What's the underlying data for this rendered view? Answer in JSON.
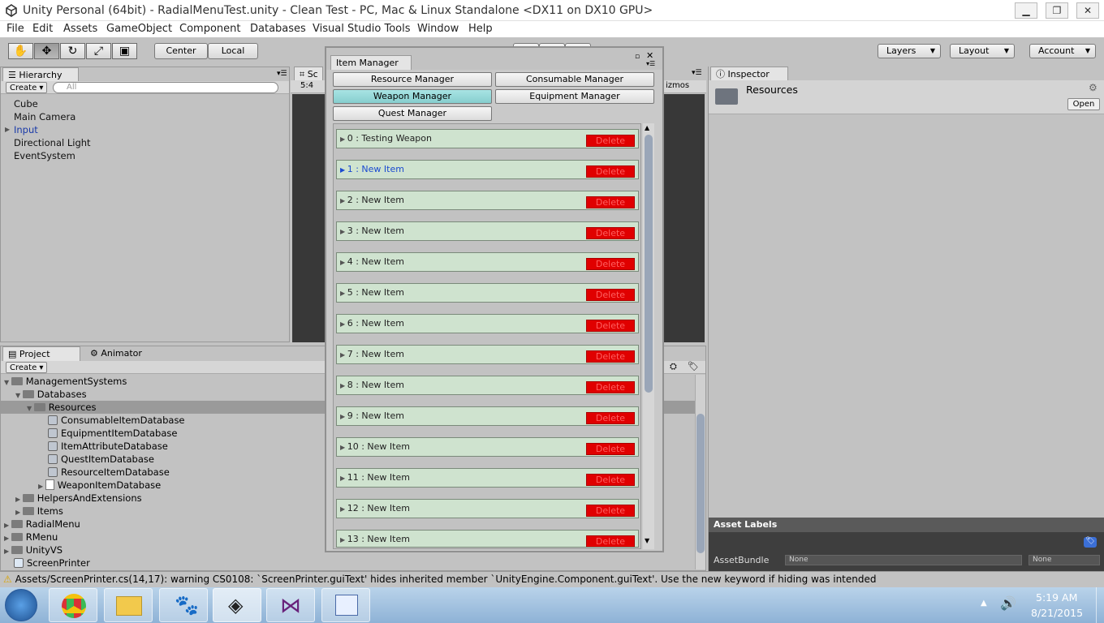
{
  "window": {
    "title": "Unity Personal (64bit) - RadialMenuTest.unity - Clean Test - PC, Mac & Linux Standalone <DX11 on DX10 GPU>",
    "controls": [
      "minimize",
      "restore",
      "close"
    ]
  },
  "menu": [
    "File",
    "Edit",
    "Assets",
    "GameObject",
    "Component",
    "Databases",
    "Visual Studio Tools",
    "Window",
    "Help"
  ],
  "toolbar": {
    "center": "Center",
    "local": "Local",
    "layers": "Layers",
    "layout": "Layout",
    "account": "Account"
  },
  "hierarchy": {
    "tab": "Hierarchy",
    "create": "Create",
    "search_placeholder": "All",
    "items": [
      "Cube",
      "Main Camera",
      "Input",
      "Directional Light",
      "EventSystem"
    ]
  },
  "scene": {
    "tab": "Sc",
    "aspect": "5:4",
    "gizmos": "izmos"
  },
  "project": {
    "tab": "Project",
    "tab2": "Animator",
    "create": "Create",
    "tree": [
      "ManagementSystems",
      "Databases",
      "Resources",
      "ConsumableItemDatabase",
      "EquipmentItemDatabase",
      "ItemAttributeDatabase",
      "QuestItemDatabase",
      "ResourceItemDatabase",
      "WeaponItemDatabase",
      "HelpersAndExtensions",
      "Items",
      "RadialMenu",
      "RMenu",
      "UnityVS",
      "ScreenPrinter"
    ]
  },
  "item_manager": {
    "tab": "Item Manager",
    "buttons": {
      "resource": "Resource Manager",
      "consumable": "Consumable Manager",
      "weapon": "Weapon Manager",
      "equipment": "Equipment Manager",
      "quest": "Quest Manager"
    },
    "delete_label": "Delete",
    "items": [
      "0 : Testing Weapon",
      "1 : New Item",
      "2 : New Item",
      "3 : New Item",
      "4 : New Item",
      "5 : New Item",
      "6 : New Item",
      "7 : New Item",
      "8 : New Item",
      "9 : New Item",
      "10 : New Item",
      "11 : New Item",
      "12 : New Item",
      "13 : New Item"
    ]
  },
  "inspector": {
    "tab": "Inspector",
    "name": "Resources",
    "open": "Open",
    "asset_labels": "Asset Labels",
    "asset_bundle": "AssetBundle",
    "bundle_value": "None",
    "variant_value": "None"
  },
  "console": {
    "message": "Assets/ScreenPrinter.cs(14,17): warning CS0108: `ScreenPrinter.guiText' hides inherited member `UnityEngine.Component.guiText'. Use the new keyword if hiding was intended"
  },
  "taskbar": {
    "time": "5:19 AM",
    "date": "8/21/2015"
  },
  "colors": {
    "selected_tab": "#86cece",
    "row_bg": "#cfe3cf",
    "delete": "#e00000",
    "link_blue": "#1a4ad0"
  }
}
